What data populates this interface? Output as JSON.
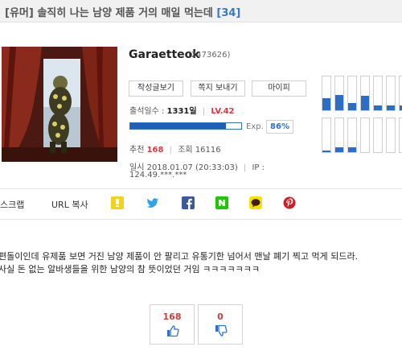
{
  "post": {
    "title": "[유머] 솔직히 나는 남양 제품 거의 매일 먹는데",
    "comment_count": "[34]"
  },
  "profile": {
    "nickname": "Garaetteok",
    "user_id": "(2473626)",
    "buttons": [
      "작성글보기",
      "쪽지 보내기",
      "마이피"
    ],
    "attendance_label": "출석일수 :",
    "attendance_value": "1331일",
    "level": "LV.42",
    "exp_label": "Exp.",
    "exp_percent": "86%",
    "exp_fraction": 0.86,
    "recommend_label": "추천",
    "recommend_value": "168",
    "views_label": "조회",
    "views_value": "16116",
    "date": "일시 2018.01.07 (20:33:03)",
    "ip_label": "IP :",
    "ip_value": "124.49.***.***"
  },
  "activity_columns": [
    {
      "top": 0.0,
      "bottom": 0.35
    },
    {
      "top": 0.0,
      "bottom": 0.45
    },
    {
      "top": 0.0,
      "bottom": 0.22
    },
    {
      "top": 0.0,
      "bottom": 0.42
    },
    {
      "top": 0.0,
      "bottom": 0.15
    },
    {
      "top": 0.0,
      "bottom": 0.15
    },
    {
      "top": 0.0,
      "bottom": 0.15
    },
    {
      "top": 0.0,
      "bottom": 0.05
    },
    {
      "top": 0.0,
      "bottom": 0.15
    },
    {
      "top": 0.0,
      "bottom": 0.15
    },
    {
      "top": 0.0,
      "bottom": 0.0
    },
    {
      "top": 0.0,
      "bottom": 0.0
    },
    {
      "top": 0.0,
      "bottom": 0.0
    },
    {
      "top": 0.0,
      "bottom": 0.0
    }
  ],
  "share": {
    "scrap_label": "스크랩",
    "url_copy_label": "URL 복사"
  },
  "content": {
    "line1": "편돌이인데 유제품 보면 거진 남양 제품이 안 팔리고 유통기한 넘어서 맨날 폐기 찍고 먹게 되드라.",
    "line2": "사실 돈 없는 알바생들을 위한 남양의 참 뜻이었던 거임 ㅋㅋㅋㅋㅋㅋㅋ"
  },
  "votes": {
    "up": "168",
    "down": "0"
  },
  "colors": {
    "accent": "#2f6fc4",
    "red": "#d23c3c"
  },
  "icons": [
    "scrap-icon",
    "naver-blog-icon",
    "twitter-icon",
    "facebook-icon",
    "naver-icon",
    "kakaotalk-icon",
    "pinterest-icon",
    "thumbs-up-icon",
    "thumbs-down-icon"
  ]
}
